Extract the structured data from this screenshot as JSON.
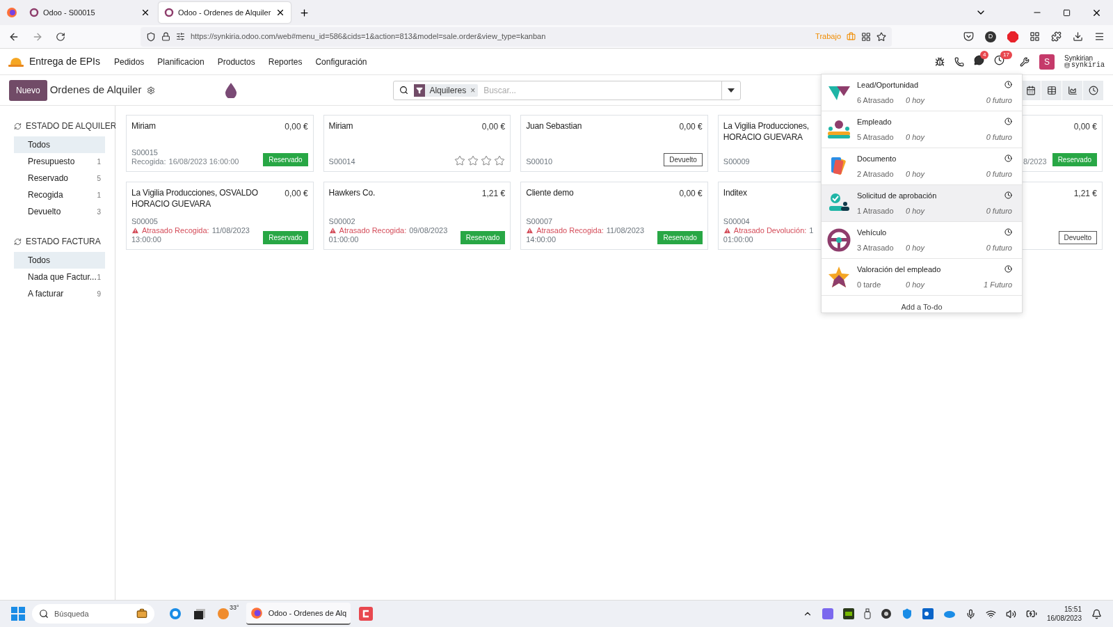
{
  "browser": {
    "tabs": [
      {
        "title": "Odoo - S00015",
        "selected": false
      },
      {
        "title": "Odoo - Ordenes de Alquiler",
        "selected": true
      }
    ],
    "url": "https://synkiria.odoo.com/web#menu_id=586&cids=1&action=813&model=sale.order&view_type=kanban",
    "container": "Trabajo",
    "profile": "D"
  },
  "navbar": {
    "app": "Entrega de EPIs",
    "menus": [
      "Pedidos",
      "Planificacion",
      "Productos",
      "Reportes",
      "Configuración"
    ],
    "chat_count": "4",
    "activity_count": "17",
    "avatar": "S",
    "user": "Synkirian",
    "db": "synkiria"
  },
  "control": {
    "new_button": "Nuevo",
    "title": "Ordenes de Alquiler",
    "facet": "Alquileres",
    "facet_remove": "×",
    "search_placeholder": "Buscar..."
  },
  "sidebar": [
    {
      "title": "ESTADO DE ALQUILER",
      "items": [
        {
          "label": "Todos",
          "selected": true
        },
        {
          "label": "Presupuesto",
          "count": "1",
          "selected": false
        },
        {
          "label": "Reservado",
          "count": "5",
          "selected": false
        },
        {
          "label": "Recogida",
          "count": "1",
          "selected": false
        },
        {
          "label": "Devuelto",
          "count": "3",
          "selected": false
        }
      ]
    },
    {
      "title": "ESTADO FACTURA",
      "items": [
        {
          "label": "Todos",
          "selected": true
        },
        {
          "label": "Nada que Factur...",
          "count": "1",
          "selected": false
        },
        {
          "label": "A facturar",
          "count": "9",
          "selected": false
        }
      ]
    }
  ],
  "cards": [
    {
      "title_lines": [
        "Miriam"
      ],
      "price": "0,00 €",
      "ref": "S00015",
      "date_label": "Recogida:",
      "date": "16/08/2023 16:00:00",
      "overdue": false,
      "badge": {
        "label": "Reservado",
        "kind": "reserved"
      }
    },
    {
      "title_lines": [
        "Miriam"
      ],
      "price": "0,00 €",
      "ref": "S00014",
      "stars": 0
    },
    {
      "title_lines": [
        "Juan Sebastian"
      ],
      "price": "0,00 €",
      "ref": "S00010",
      "badge": {
        "label": "Devuelto",
        "kind": "returned"
      }
    },
    {
      "title_lines": [
        "La Vigilia Producciones,",
        "HORACIO GUEVARA"
      ],
      "ref": "S00009"
    },
    {
      "price": "0,00 €",
      "date": "8/2023",
      "overdue": false,
      "badge": {
        "label": "Reservado",
        "kind": "reserved"
      }
    },
    {
      "title_lines": [
        "La Vigilia Producciones, OSVALDO HORACIO GUEVARA"
      ],
      "price": "0,00 €",
      "ref": "S00005",
      "date_label": "Atrasado Recogida:",
      "date": "11/08/2023",
      "time": "13:00:00",
      "overdue": true,
      "badge": {
        "label": "Reservado",
        "kind": "reserved"
      }
    },
    {
      "title_lines": [
        "Hawkers Co."
      ],
      "price": "1,21 €",
      "ref": "S00002",
      "date_label": "Atrasado Recogida:",
      "date": "09/08/2023",
      "time": "01:00:00",
      "overdue": true,
      "badge": {
        "label": "Reservado",
        "kind": "reserved"
      }
    },
    {
      "title_lines": [
        "Cliente demo"
      ],
      "price": "0,00 €",
      "ref": "S00007",
      "date_label": "Atrasado Recogida:",
      "date": "11/08/2023",
      "time": "14:00:00",
      "overdue": true,
      "badge": {
        "label": "Reservado",
        "kind": "reserved"
      }
    },
    {
      "title_lines": [
        "Inditex"
      ],
      "ref": "S00004",
      "date_label": "Atrasado Devolución:",
      "date": "1",
      "time": "01:00:00",
      "overdue": true
    },
    {
      "price": "1,21 €",
      "badge": {
        "label": "Devuelto",
        "kind": "returned"
      }
    }
  ],
  "activity_menu": {
    "items": [
      {
        "kind": "lead",
        "name": "Lead/Oportunidad",
        "late": "6 Atrasado",
        "today": "0 hoy",
        "future": "0 futuro",
        "selected": false
      },
      {
        "kind": "employee",
        "name": "Empleado",
        "late": "5 Atrasado",
        "today": "0 hoy",
        "future": "0 futuro",
        "selected": false
      },
      {
        "kind": "document",
        "name": "Documento",
        "late": "2 Atrasado",
        "today": "0 hoy",
        "future": "0 futuro",
        "selected": false
      },
      {
        "kind": "approval",
        "name": "Solicitud de aprobación",
        "late": "1 Atrasado",
        "today": "0 hoy",
        "future": "0 futuro",
        "selected": true
      },
      {
        "kind": "vehicle",
        "name": "Vehículo",
        "late": "3 Atrasado",
        "today": "0 hoy",
        "future": "0 futuro",
        "selected": false
      },
      {
        "kind": "rating",
        "name": "Valoración del empleado",
        "late": "0 tarde",
        "today": "0 hoy",
        "future": "1 Futuro",
        "selected": false
      }
    ],
    "add_link": "Add a To-do"
  },
  "taskbar": {
    "search": "Búsqueda",
    "weather": "33°",
    "window": "Odoo - Ordenes de Alq",
    "time": "15:51",
    "date": "16/08/2023"
  }
}
